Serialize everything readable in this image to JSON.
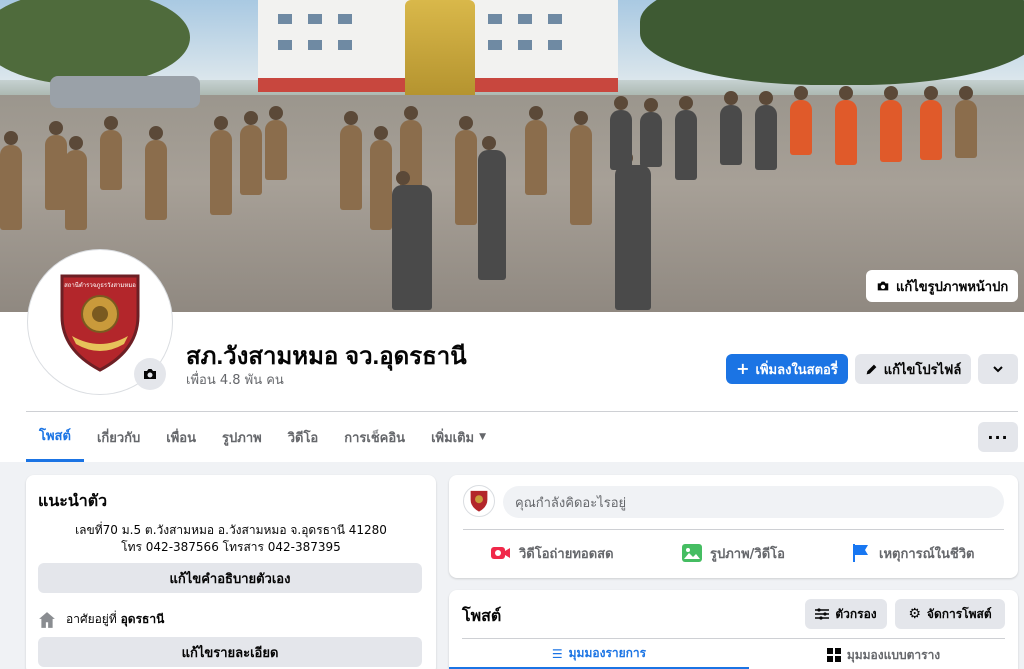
{
  "cover": {
    "edit_label": "แก้ไขรูปภาพหน้าปก"
  },
  "profile": {
    "name": "สภ.วังสามหมอ จว.อุดรธานี",
    "friends": "เพื่อน 4.8 พัน คน",
    "add_story_label": "เพิ่มลงในสตอรี่",
    "edit_profile_label": "แก้ไขโปรไฟล์",
    "badge_text": "สถานีตำรวจภูธรวังสามหมอ"
  },
  "tabs": [
    {
      "label": "โพสต์"
    },
    {
      "label": "เกี่ยวกับ"
    },
    {
      "label": "เพื่อน"
    },
    {
      "label": "รูปภาพ"
    },
    {
      "label": "วิดีโอ"
    },
    {
      "label": "การเช็คอิน"
    },
    {
      "label": "เพิ่มเติม"
    }
  ],
  "tabs_more_dots": "···",
  "intro": {
    "title": "แนะนำตัว",
    "address": "เลขที่70 ม.5 ต.วังสามหมอ อ.วังสามหมอ จ.อุดรธานี 41280",
    "phone": "โทร 042-387566 โทรสาร 042-387395",
    "edit_bio_label": "แก้ไขคำอธิบายตัวเอง",
    "lives_in_prefix": "อาศัยอยู่ที่",
    "lives_in_city": "อุดรธานี",
    "edit_details_label": "แก้ไขรายละเอียด"
  },
  "composer": {
    "placeholder": "คุณกำลังคิดอะไรอยู่",
    "live_video_label": "วิดีโอถ่ายทอดสด",
    "photo_video_label": "รูปภาพ/วิดีโอ",
    "life_event_label": "เหตุการณ์ในชีวิต"
  },
  "posts": {
    "title": "โพสต์",
    "filter_label": "ตัวกรอง",
    "manage_label": "จัดการโพสต์",
    "list_view_label": "มุมมองรายการ",
    "grid_view_label": "มุมมองแบบตาราง"
  },
  "colors": {
    "accent": "#1b74e4",
    "background": "#f0f2f5",
    "secondary_button": "#e4e6eb",
    "live_red": "#f02849",
    "photo_green": "#45bd62",
    "event_blue": "#1877f2"
  }
}
